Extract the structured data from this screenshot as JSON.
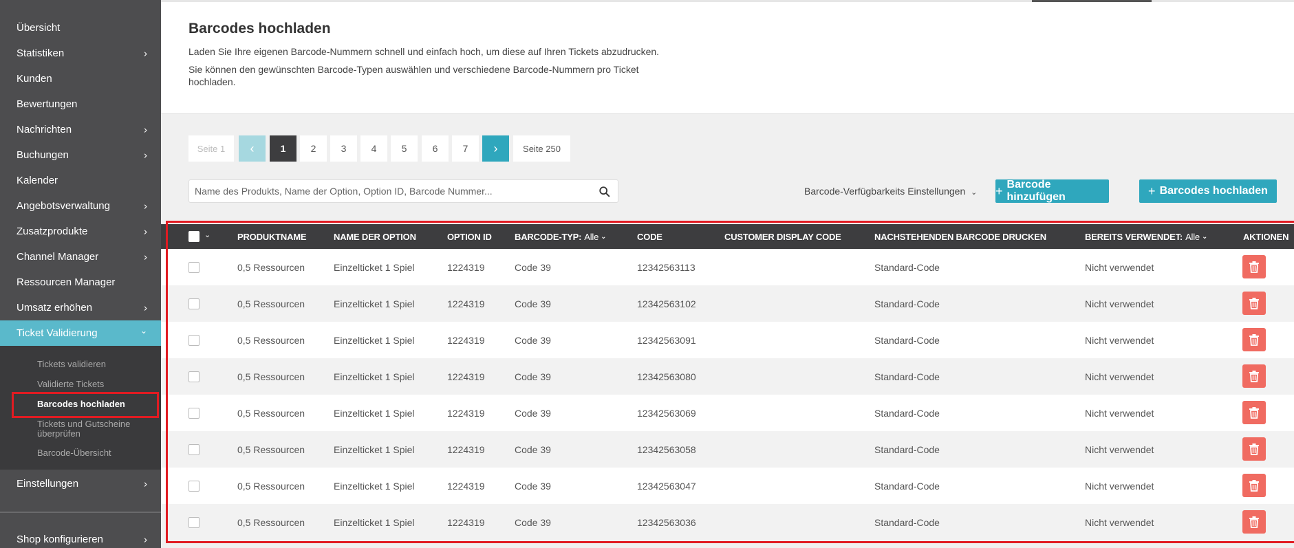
{
  "sidebar": {
    "items": [
      {
        "label": "Übersicht",
        "chevron": false
      },
      {
        "label": "Statistiken",
        "chevron": true
      },
      {
        "label": "Kunden",
        "chevron": false
      },
      {
        "label": "Bewertungen",
        "chevron": false
      },
      {
        "label": "Nachrichten",
        "chevron": true
      },
      {
        "label": "Buchungen",
        "chevron": true
      },
      {
        "label": "Kalender",
        "chevron": false
      },
      {
        "label": "Angebotsverwaltung",
        "chevron": true
      },
      {
        "label": "Zusatzprodukte",
        "chevron": true
      },
      {
        "label": "Channel Manager",
        "chevron": true
      },
      {
        "label": "Ressourcen Manager",
        "chevron": false
      },
      {
        "label": "Umsatz erhöhen",
        "chevron": true
      },
      {
        "label": "Ticket Validierung",
        "chevron": true,
        "active": true
      }
    ],
    "subitems": [
      "Tickets validieren",
      "Validierte Tickets",
      "Barcodes hochladen",
      "Tickets und Gutscheine überprüfen",
      "Barcode-Übersicht"
    ],
    "after": [
      {
        "label": "Einstellungen"
      },
      {
        "label": "Shop konfigurieren"
      }
    ]
  },
  "header": {
    "title": "Barcodes hochladen",
    "desc1": "Laden Sie Ihre eigenen Barcode-Nummern schnell und einfach hoch, um diese auf Ihren Tickets abzudrucken.",
    "desc2": "Sie können den gewünschten Barcode-Typen auswählen und verschiedene Barcode-Nummern pro Ticket hochladen."
  },
  "pagination": {
    "first_label": "Seite 1",
    "pages": [
      "1",
      "2",
      "3",
      "4",
      "5",
      "6",
      "7"
    ],
    "last_label": "Seite 250",
    "prev": "‹",
    "next": "›"
  },
  "search": {
    "placeholder": "Name des Produkts, Name der Option, Option ID, Barcode Nummer..."
  },
  "toolbar": {
    "availability": "Barcode-Verfügbarkeits Einstellungen",
    "add_barcode": "Barcode hinzufügen",
    "upload_barcodes": "Barcodes hochladen"
  },
  "table": {
    "columns": {
      "product": "PRODUKTNAME",
      "option_name": "NAME DER OPTION",
      "option_id": "OPTION ID",
      "barcode_type": "BARCODE-TYP:",
      "barcode_type_filter": "Alle",
      "code": "CODE",
      "customer_code": "CUSTOMER DISPLAY CODE",
      "print": "NACHSTEHENDEN BARCODE DRUCKEN",
      "used": "BEREITS VERWENDET:",
      "used_filter": "Alle",
      "actions": "AKTIONEN"
    },
    "rows": [
      {
        "product": "0,5 Ressourcen",
        "option_name": "Einzelticket 1 Spiel",
        "option_id": "1224319",
        "type": "Code 39",
        "code": "12342563113",
        "customer_code": "",
        "print": "Standard-Code",
        "used": "Nicht verwendet"
      },
      {
        "product": "0,5 Ressourcen",
        "option_name": "Einzelticket 1 Spiel",
        "option_id": "1224319",
        "type": "Code 39",
        "code": "12342563102",
        "customer_code": "",
        "print": "Standard-Code",
        "used": "Nicht verwendet"
      },
      {
        "product": "0,5 Ressourcen",
        "option_name": "Einzelticket 1 Spiel",
        "option_id": "1224319",
        "type": "Code 39",
        "code": "12342563091",
        "customer_code": "",
        "print": "Standard-Code",
        "used": "Nicht verwendet"
      },
      {
        "product": "0,5 Ressourcen",
        "option_name": "Einzelticket 1 Spiel",
        "option_id": "1224319",
        "type": "Code 39",
        "code": "12342563080",
        "customer_code": "",
        "print": "Standard-Code",
        "used": "Nicht verwendet"
      },
      {
        "product": "0,5 Ressourcen",
        "option_name": "Einzelticket 1 Spiel",
        "option_id": "1224319",
        "type": "Code 39",
        "code": "12342563069",
        "customer_code": "",
        "print": "Standard-Code",
        "used": "Nicht verwendet"
      },
      {
        "product": "0,5 Ressourcen",
        "option_name": "Einzelticket 1 Spiel",
        "option_id": "1224319",
        "type": "Code 39",
        "code": "12342563058",
        "customer_code": "",
        "print": "Standard-Code",
        "used": "Nicht verwendet"
      },
      {
        "product": "0,5 Ressourcen",
        "option_name": "Einzelticket 1 Spiel",
        "option_id": "1224319",
        "type": "Code 39",
        "code": "12342563047",
        "customer_code": "",
        "print": "Standard-Code",
        "used": "Nicht verwendet"
      },
      {
        "product": "0,5 Ressourcen",
        "option_name": "Einzelticket 1 Spiel",
        "option_id": "1224319",
        "type": "Code 39",
        "code": "12342563036",
        "customer_code": "",
        "print": "Standard-Code",
        "used": "Nicht verwendet"
      }
    ]
  },
  "colors": {
    "sidebar_bg": "#4d4d4f",
    "accent": "#2fa7bd",
    "active_nav": "#5ab9cb",
    "delete": "#f06b61",
    "highlight": "#e11b22"
  }
}
